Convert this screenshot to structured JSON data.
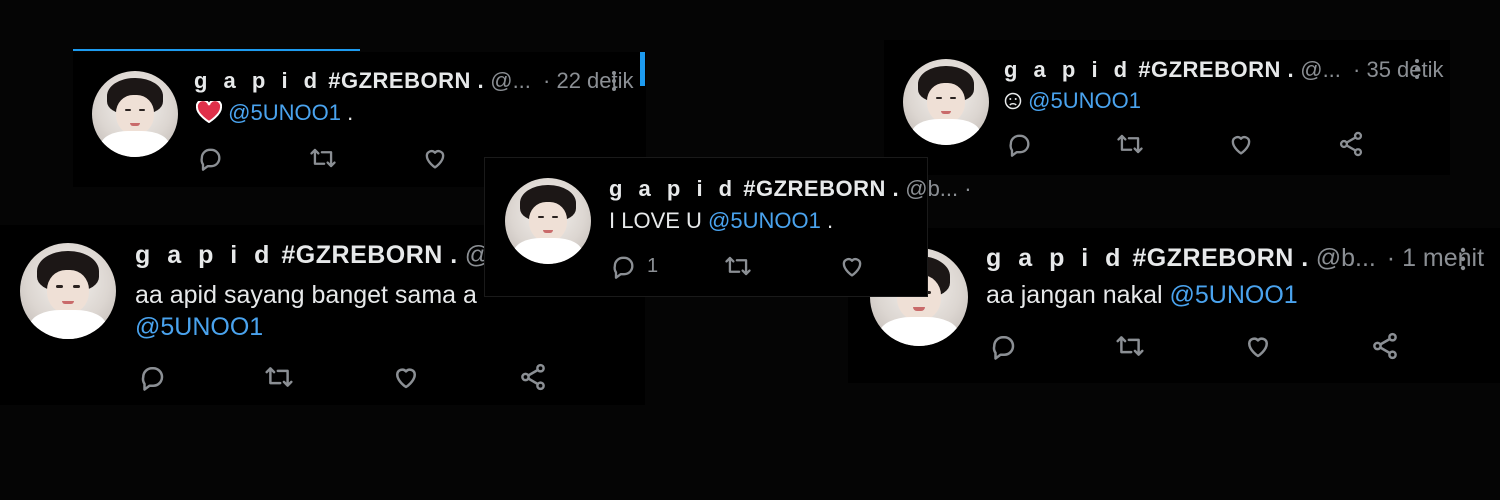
{
  "colors": {
    "background": "#050505",
    "card": "#000000",
    "text": "#e7e9ea",
    "muted": "#8b8f94",
    "mention": "#4aa3ee",
    "accent": "#1d9bf0"
  },
  "tweets": [
    {
      "name_spaced": "g a p i d",
      "name_tag": "#GZREBORN .",
      "handle": "@...",
      "time": "· 22 detik",
      "emoji": "heart-emoji",
      "mention": "@5UNOO1",
      "suffix": ".",
      "reply_count": "",
      "icons": [
        "reply-icon",
        "retweet-icon",
        "like-icon",
        "share-icon"
      ]
    },
    {
      "name_spaced": "g a p i d",
      "name_tag": "#GZREBORN .",
      "handle": "@...",
      "time": "· 35 detik",
      "emoji": "frown-emoji",
      "mention": "@5UNOO1",
      "suffix": "",
      "reply_count": ""
    },
    {
      "name_spaced": "g a p i d",
      "name_tag": "#GZREBORN .",
      "handle": "@b...",
      "time": "·",
      "text": "I LOVE U",
      "mention": "@5UNOO1",
      "suffix": ".",
      "reply_count": "1"
    },
    {
      "name_spaced": "g a p i d",
      "name_tag": "#GZREBORN .",
      "handle": "@b...",
      "time": "·",
      "text": "aa apid sayang banget sama a",
      "mention": "@5UNOO1"
    },
    {
      "name_spaced": "g a p i d",
      "name_tag": "#GZREBORN .",
      "handle": "@b...",
      "time": "· 1 menit",
      "text": "aa jangan nakal",
      "mention": "@5UNOO1"
    }
  ]
}
